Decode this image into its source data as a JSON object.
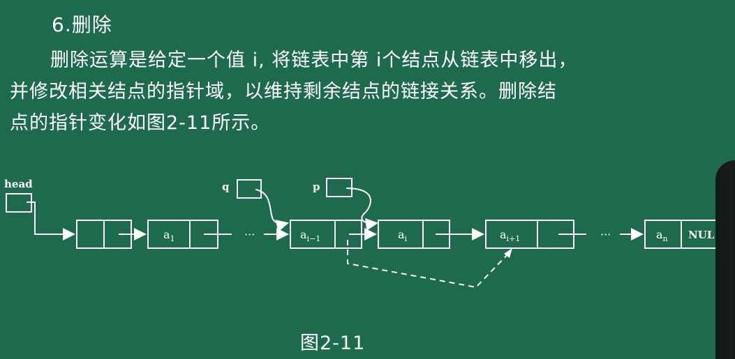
{
  "section": {
    "heading": "6.删除"
  },
  "paragraph": {
    "line1": "删除运算是给定一个值 i, 将链表中第 i个结点从链表中移出，",
    "line2": "并修改相关结点的指针域，以维持剩余结点的链接关系。删除结",
    "line3": "点的指针变化如图2-11所示。"
  },
  "diagram": {
    "head_label": "head",
    "q_label": "q",
    "p_label": "p",
    "node_a1": {
      "main": "a",
      "sub": "1"
    },
    "node_ai_minus1": {
      "main": "a",
      "sub": "i−1"
    },
    "node_ai": {
      "main": "a",
      "sub": "i"
    },
    "node_ai_plus1": {
      "main": "a",
      "sub": "i+1"
    },
    "node_an": {
      "main": "a",
      "sub": "n"
    },
    "null_label": "NUL",
    "ellipsis": "···"
  },
  "caption": "图2-11",
  "colors": {
    "background": "#1e6a4c",
    "ink": "#ffffff"
  }
}
